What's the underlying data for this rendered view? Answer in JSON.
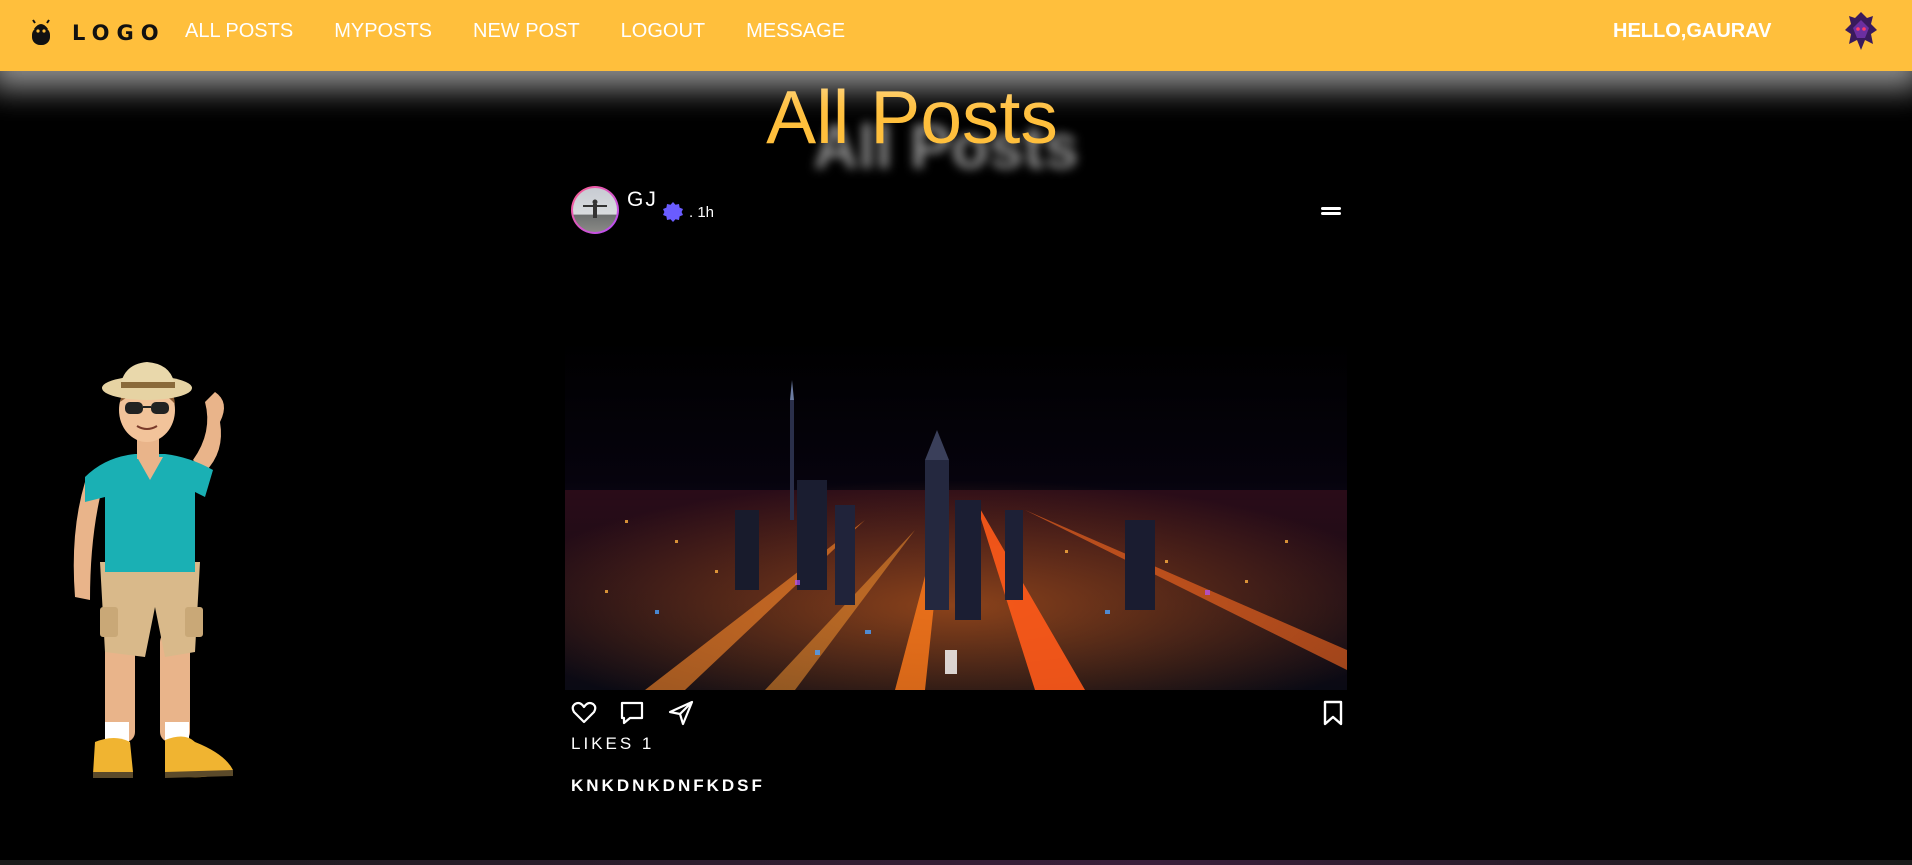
{
  "app": {
    "logo_text": "LOGO"
  },
  "nav": {
    "links": [
      {
        "label": "ALL POSTS"
      },
      {
        "label": "MYPOSTS"
      },
      {
        "label": "NEW POST"
      },
      {
        "label": "LOGOUT"
      },
      {
        "label": "MESSAGE"
      }
    ],
    "greeting": "HELLO,GAURAV"
  },
  "page": {
    "title": "All Posts"
  },
  "post": {
    "username": "GJ",
    "time": ". 1h",
    "likes_text": "LIKES 1",
    "caption": "KNKDNKDNFKDSF"
  },
  "colors": {
    "accent": "#ffbf3c",
    "background": "#000000",
    "verified": "#6a5cff"
  }
}
